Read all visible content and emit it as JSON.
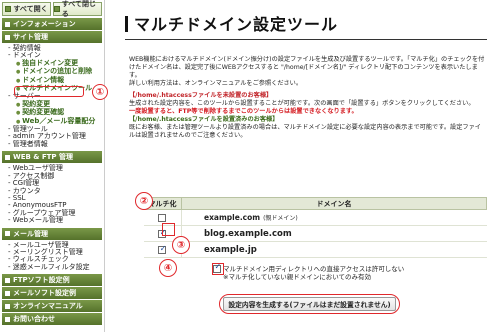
{
  "sidebar": {
    "expand_label": "すべて開く",
    "collapse_label": "すべて閉じる",
    "sections": [
      {
        "title": "インフォメーション",
        "items": []
      },
      {
        "title": "サイト管理",
        "items": [
          {
            "label": "契約情報",
            "sub": false
          },
          {
            "label": "ドメイン",
            "sub": false
          },
          {
            "label": "独自ドメイン変更",
            "sub": true
          },
          {
            "label": "ドメインの追加と削除",
            "sub": true
          },
          {
            "label": "ドメイン情報",
            "sub": true
          },
          {
            "label": "マルチドメインツール",
            "sub": true,
            "highlight": true
          },
          {
            "label": "サーバー",
            "sub": false
          },
          {
            "label": "契約変更",
            "sub": true
          },
          {
            "label": "契約変更確認",
            "sub": true
          },
          {
            "label": "Web／メール容量配分",
            "sub": true
          },
          {
            "label": "管理ツール",
            "sub": false
          },
          {
            "label": "admin アカウント管理",
            "sub": false
          },
          {
            "label": "管理者情報",
            "sub": false
          }
        ]
      },
      {
        "title": "WEB & FTP 管理",
        "items": [
          {
            "label": "Webユーザ管理",
            "sub": false
          },
          {
            "label": "アクセス制御",
            "sub": false
          },
          {
            "label": "CGI管理",
            "sub": false
          },
          {
            "label": "カウンタ",
            "sub": false
          },
          {
            "label": "SSL",
            "sub": false
          },
          {
            "label": "AnonymousFTP",
            "sub": false
          },
          {
            "label": "グループウェア管理",
            "sub": false
          },
          {
            "label": "Webメール管理",
            "sub": false
          }
        ]
      },
      {
        "title": "メール管理",
        "items": [
          {
            "label": "メールユーザ管理",
            "sub": false
          },
          {
            "label": "メーリングリスト管理",
            "sub": false
          },
          {
            "label": "ウィルスチェック",
            "sub": false
          },
          {
            "label": "迷惑メールフィルタ設定",
            "sub": false
          }
        ]
      },
      {
        "title": "FTPソフト設定例",
        "items": []
      },
      {
        "title": "メールソフト設定例",
        "items": []
      },
      {
        "title": "オンラインマニュアル",
        "items": []
      },
      {
        "title": "お問い合わせ",
        "items": []
      }
    ]
  },
  "main": {
    "title": "マルチドメイン設定ツール",
    "desc1": "WEB機能におけるマルチドメイン(ドメイン振分け)の設定ファイルを生成及び設置するツールです。「マルチ化」のチェックを付けたドメイン名は、設定完了後にWEBアクセスすると \"/home/[ドメイン名]/\" ディレクトリ配下のコンテンツを表示いたします。",
    "desc2": "詳しい利用方法は、オンラインマニュアルをご参照ください。",
    "h1": "【/home/.htaccessファイルを未設置のお客様】",
    "h1_text": "生成された設定内容を、このツールから設置することが可能です。次の画面で「設置する」ボタンをクリックしてください。",
    "h1_warn": "一度設置すると、FTP等で削除するまでこのツールからは設置できなくなります。",
    "h2": "【/home/.htaccessファイルを設置済みのお客様】",
    "h2_text": "既にお客様、または管理ツールより設置済みの場合は、マルチドメイン設定に必要な設定内容の表示まで可能です。設定ファイルは設置されませんのでご注意ください。",
    "table": {
      "col_multi": "マルチ化",
      "col_domain": "ドメイン名",
      "rows": [
        {
          "domain": "example.com",
          "note": "(親ドメイン)",
          "checked": false
        },
        {
          "domain": "blog.example.com",
          "note": "",
          "checked": true
        },
        {
          "domain": "example.jp",
          "note": "",
          "checked": true
        }
      ]
    },
    "option_label": "マルチドメイン用ディレクトリへの直接アクセスは許可しない",
    "option_note": "※マルチ化していない親ドメインにおいてのみ有効",
    "generate_button": "設定内容を生成する(ファイルはまだ設置されません)"
  },
  "callouts": [
    "①",
    "②",
    "③",
    "④"
  ]
}
